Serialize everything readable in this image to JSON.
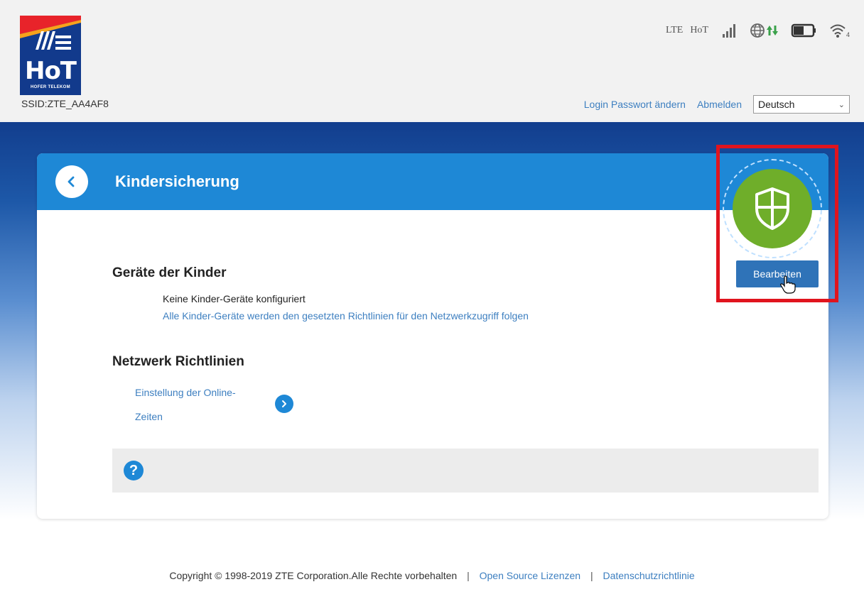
{
  "header": {
    "logo_text": "HoT",
    "logo_subtext": "HOFER TELEKOM",
    "ssid": "SSID:ZTE_AA4AF8",
    "status": {
      "network_type": "LTE",
      "carrier": "HoT",
      "wifi_clients": "4"
    },
    "links": {
      "change_password": "Login Passwort ändern",
      "logout": "Abmelden"
    },
    "language": {
      "selected": "Deutsch"
    }
  },
  "card": {
    "title": "Kindersicherung",
    "children_devices": {
      "title": "Geräte der Kinder",
      "status": "Keine Kinder-Geräte konfiguriert",
      "info": "Alle Kinder-Geräte werden den gesetzten Richtlinien für den Netzwerkzugriff folgen"
    },
    "network_policies": {
      "title": "Netzwerk Richtlinien",
      "online_time_line1": "Einstellung der Online-",
      "online_time_line2": "Zeiten"
    },
    "edit_label": "Bearbeiten"
  },
  "footer": {
    "copyright": "Copyright © 1998-2019 ZTE Corporation.Alle Rechte vorbehalten",
    "open_source": "Open Source Lizenzen",
    "privacy": "Datenschutzrichtlinie"
  },
  "colors": {
    "header_bg": "#f2f2f2",
    "brand_blue": "#1e88d6",
    "band_dark": "#123e8e",
    "shield_green": "#6fae2a",
    "button_blue": "#2f73b8",
    "link": "#3d7fc0",
    "highlight": "#e0141e"
  },
  "icons": [
    "signal-icon",
    "globe-icon",
    "data-arrows-icon",
    "battery-icon",
    "wifi-icon",
    "back-chevron-icon",
    "shield-icon",
    "chevron-right-icon",
    "help-icon",
    "hand-cursor-icon"
  ]
}
